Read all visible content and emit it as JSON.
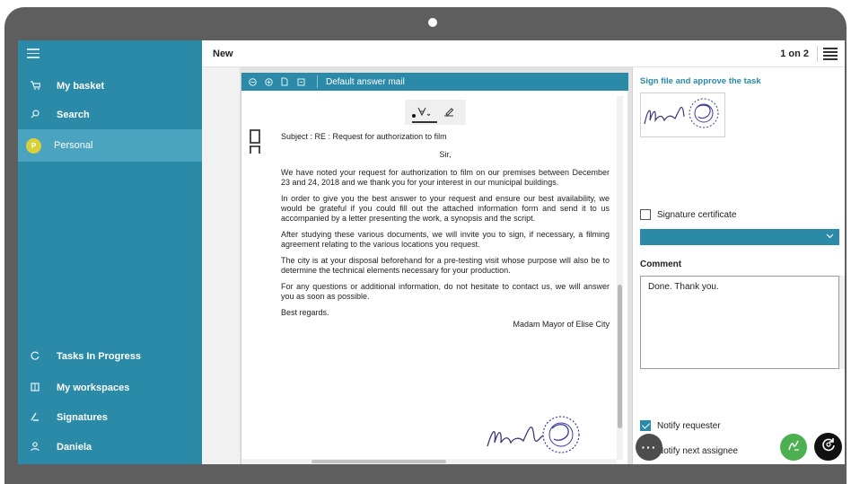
{
  "sidebar": {
    "items": [
      {
        "label": "My basket",
        "icon": "basket-icon"
      },
      {
        "label": "Search",
        "icon": "search-icon"
      },
      {
        "label": "Personal",
        "icon": "avatar",
        "avatar_letter": "P"
      },
      {
        "label": "Tasks In Progress",
        "icon": "tasks-icon"
      },
      {
        "label": "My workspaces",
        "icon": "workspaces-icon"
      },
      {
        "label": "Signatures",
        "icon": "signature-icon"
      },
      {
        "label": "Daniela",
        "icon": "user-icon"
      }
    ]
  },
  "header": {
    "title": "New",
    "pager": "1 on 2"
  },
  "viewer": {
    "toolbar_label": "Default answer mail"
  },
  "letter": {
    "subject": "Subject : RE : Request for authorization to film",
    "salutation": "Sir,",
    "paragraphs": [
      "We have noted your request for authorization to film on our premises between December 23 and 24, 2018 and we thank you for your interest in our municipal buildings.",
      "In order to give you the best answer to your request and ensure our best availability, we would be grateful if you could fill out the attached information form and send it to us accompanied by a letter presenting the work, a synopsis and the script.",
      "After studying these various documents, we will invite you to sign, if necessary, a filming agreement relating to the various locations you request.",
      "The city is at your disposal beforehand for a pre-testing visit whose purpose will also be to determine the technical elements necessary for your production.",
      "For any questions or additional information, do not hesitate to contact us, we will answer you as soon as possible."
    ],
    "closing": "Best regards.",
    "signatory": "Madam Mayor of Elise City"
  },
  "panel": {
    "heading": "Sign file and approve the task",
    "signature_certificate_label": "Signature certificate",
    "comment_label": "Comment",
    "comment_value": "Done. Thank you.",
    "notify_requester_label": "Notify requester",
    "notify_requester_checked": true,
    "notify_next_label": "Notify next assignee",
    "notify_next_checked": false
  },
  "actions": {
    "more_label": "···"
  },
  "colors": {
    "accent": "#2a8aa8",
    "sidebar_active": "#4aa3bf",
    "sign_button": "#4caf50",
    "frame": "#5e5e5e"
  }
}
